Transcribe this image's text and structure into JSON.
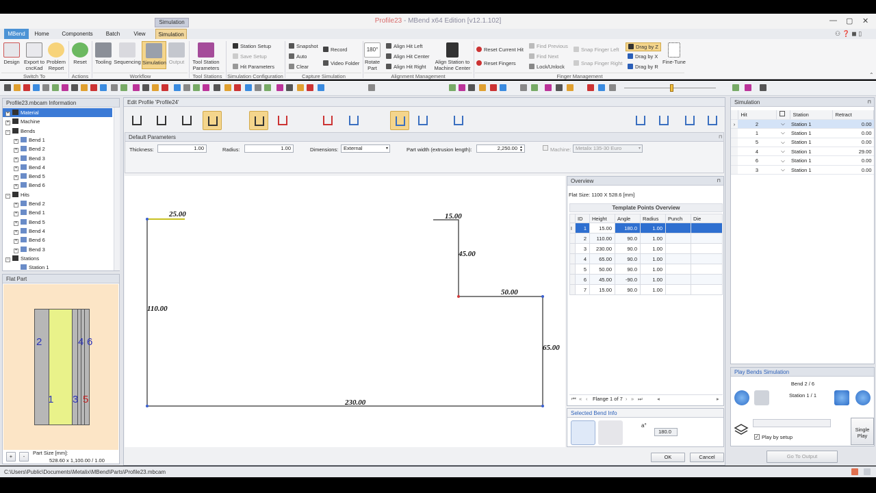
{
  "window": {
    "title": "Profile23",
    "title_suffix": " - MBend x64 Edition [v12.1.102]",
    "context_tab": "Simulation"
  },
  "tabs": [
    "MBend",
    "Home",
    "Components",
    "Batch",
    "View",
    "Simulation"
  ],
  "ribbon": {
    "switch_to": {
      "group": "Switch To",
      "items": [
        "Design",
        "Export to cncKad",
        "Problem Report"
      ]
    },
    "actions": {
      "group": "Actions",
      "items": [
        "Reset"
      ]
    },
    "workflow": {
      "group": "Workflow",
      "items": [
        "Tooling",
        "Sequencing",
        "Simulation",
        "Output"
      ]
    },
    "tool_stations": {
      "group": "Tool Stations",
      "items": [
        "Tool Station Parameters"
      ]
    },
    "sim_config": {
      "group": "Simulation Configuration",
      "items": [
        "Station Setup",
        "Save Setup",
        "Hit Parameters"
      ]
    },
    "capture": {
      "group": "Capture Simulation",
      "items": [
        "Snapshot",
        "Auto",
        "Clear",
        "Record",
        "Video Folder"
      ]
    },
    "alignment": {
      "group": "Alignment Management",
      "items": [
        "Rotate Part",
        "Align Hit Left",
        "Align Hit Center",
        "Align Hit Right",
        "Align Station to Machine Center"
      ]
    },
    "finger": {
      "group": "Finger Management",
      "items": [
        "Reset Current Hit",
        "Reset Fingers",
        "Find Previous",
        "Find Next",
        "Lock/Unlock",
        "Snap Finger Left",
        "Snap Finger Right",
        "Drag by Z",
        "Drag by X",
        "Drag by R",
        "Fine-Tune"
      ]
    },
    "angle_icon": "180°"
  },
  "info_panel": {
    "title": "Profile23.mbcam Information",
    "tree": [
      {
        "label": "Material",
        "level": 0,
        "expander": "+",
        "selected": true
      },
      {
        "label": "Machine",
        "level": 0,
        "expander": "+"
      },
      {
        "label": "Bends",
        "level": 0,
        "expander": "−"
      },
      {
        "label": "Bend 1",
        "level": 1,
        "expander": "+"
      },
      {
        "label": "Bend 2",
        "level": 1,
        "expander": "+"
      },
      {
        "label": "Bend 3",
        "level": 1,
        "expander": "+"
      },
      {
        "label": "Bend 4",
        "level": 1,
        "expander": "+"
      },
      {
        "label": "Bend 5",
        "level": 1,
        "expander": "+"
      },
      {
        "label": "Bend 6",
        "level": 1,
        "expander": "+"
      },
      {
        "label": "Hits",
        "level": 0,
        "expander": "−"
      },
      {
        "label": "Bend 2",
        "level": 1,
        "expander": "+"
      },
      {
        "label": "Bend 1",
        "level": 1,
        "expander": "+"
      },
      {
        "label": "Bend 5",
        "level": 1,
        "expander": "+"
      },
      {
        "label": "Bend 4",
        "level": 1,
        "expander": "+"
      },
      {
        "label": "Bend 6",
        "level": 1,
        "expander": "+"
      },
      {
        "label": "Bend 3",
        "level": 1,
        "expander": "+"
      },
      {
        "label": "Stations",
        "level": 0,
        "expander": "−"
      },
      {
        "label": "Station 1",
        "level": 1,
        "expander": ""
      }
    ]
  },
  "flat_part": {
    "title": "Flat Part",
    "numbers": {
      "n2": "2",
      "n1": "1",
      "n3": "3",
      "n4": "4",
      "n5": "5",
      "n6": "6"
    },
    "add": "+",
    "remove": "-",
    "size_label": "Part Size [mm]:",
    "size_value": "528.60 x 1,100.00 / 1.00"
  },
  "editor": {
    "title": "Edit Profile 'Profile24'",
    "default_params": "Default Parameters",
    "thickness_label": "Thickness:",
    "thickness": "1.00",
    "radius_label": "Radius:",
    "radius": "1.00",
    "dimensions_label": "Dimensions:",
    "dimensions": "External",
    "part_width_label": "Part width (extrusion length):",
    "part_width": "2,250.00",
    "machine_label": "Machine:",
    "machine": "Metalix 135-30 Euro",
    "dims": [
      "25.00",
      "15.00",
      "45.00",
      "110.00",
      "50.00",
      "65.00",
      "230.00"
    ]
  },
  "overview": {
    "title": "Overview",
    "flat_size": "Flat Size:  1100 X 528.6 [mm]",
    "table_title": "Template Points Overview",
    "columns": [
      "ID",
      "Height",
      "Angle",
      "Radius",
      "Punch",
      "Die"
    ],
    "rows": [
      [
        "1",
        "15.00",
        "180.0",
        "1.00",
        "",
        ""
      ],
      [
        "2",
        "110.00",
        "90.0",
        "1.00",
        "",
        ""
      ],
      [
        "3",
        "230.00",
        "90.0",
        "1.00",
        "",
        ""
      ],
      [
        "4",
        "65.00",
        "90.0",
        "1.00",
        "",
        ""
      ],
      [
        "5",
        "50.00",
        "90.0",
        "1.00",
        "",
        ""
      ],
      [
        "6",
        "45.00",
        "-90.0",
        "1.00",
        "",
        ""
      ],
      [
        "7",
        "15.00",
        "90.0",
        "1.00",
        "",
        ""
      ]
    ],
    "pager": "Flange 1 of 7"
  },
  "selected_bend": {
    "title": "Selected Bend Info",
    "angle": "180.0",
    "angle_symbol": "a°"
  },
  "dialog": {
    "ok": "OK",
    "cancel": "Cancel"
  },
  "simulation": {
    "title": "Simulation",
    "columns": [
      "Hit",
      "",
      "Station",
      "Retract"
    ],
    "rows": [
      [
        "2",
        "Station 1",
        "0.00"
      ],
      [
        "1",
        "Station 1",
        "0.00"
      ],
      [
        "5",
        "Station 1",
        "0.00"
      ],
      [
        "4",
        "Station 1",
        "29.00"
      ],
      [
        "6",
        "Station 1",
        "0.00"
      ],
      [
        "3",
        "Station 1",
        "0.00"
      ]
    ]
  },
  "play": {
    "title": "Play Bends Simulation",
    "bend": "Bend 2  / 6",
    "station": "Station 1 / 1",
    "play_by_setup": "Play by setup",
    "single": "Single",
    "play": "Play",
    "go_to_output": "Go To Output"
  },
  "status": {
    "path": "C:\\Users\\Public\\Documents\\Metalix\\MBend\\Parts\\Profile23.mbcam"
  },
  "colors": {
    "accent": "#2e6fd0",
    "ribbon_active": "#f2d79c",
    "mbend_tab": "#4c93d5"
  }
}
